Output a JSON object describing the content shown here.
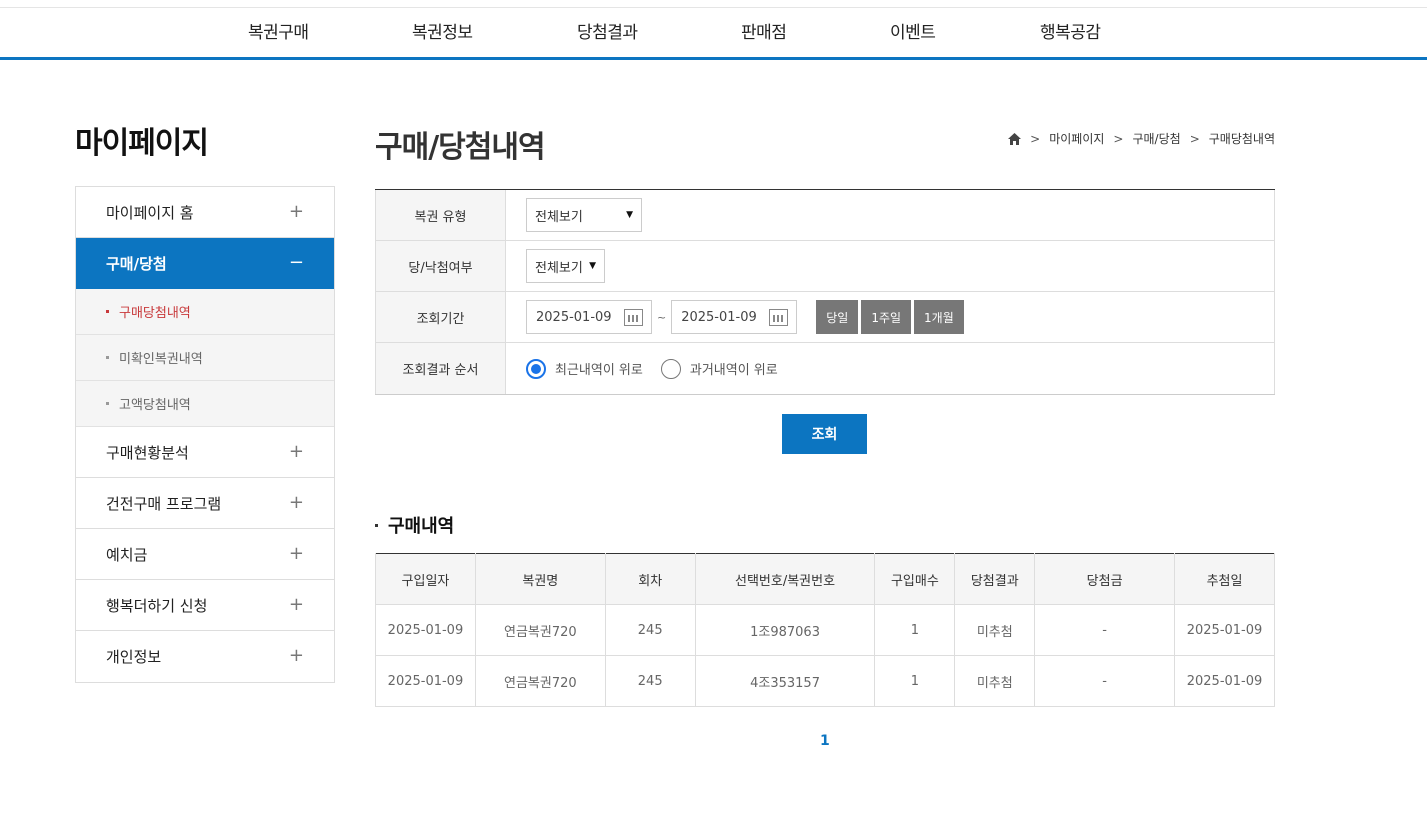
{
  "gnb": [
    "복권구매",
    "복권정보",
    "당첨결과",
    "판매점",
    "이벤트",
    "행복공감"
  ],
  "lnb": {
    "title": "마이페이지",
    "items": [
      {
        "label": "마이페이지 홈",
        "toggle": "+"
      },
      {
        "label": "구매/당첨",
        "toggle": "−"
      },
      {
        "label": "구매현황분석",
        "toggle": "+"
      },
      {
        "label": "건전구매 프로그램",
        "toggle": "+"
      },
      {
        "label": "예치금",
        "toggle": "+"
      },
      {
        "label": "행복더하기 신청",
        "toggle": "+"
      },
      {
        "label": "개인정보",
        "toggle": "+"
      }
    ],
    "sub": [
      "구매당첨내역",
      "미확인복권내역",
      "고액당첨내역"
    ]
  },
  "page": {
    "title": "구매/당첨내역",
    "breadcrumb": [
      "마이페이지",
      "구매/당첨",
      "구매당첨내역"
    ]
  },
  "search": {
    "type_label": "복권 유형",
    "type_value": "전체보기",
    "win_label": "당/낙첨여부",
    "win_value": "전체보기",
    "period_label": "조회기간",
    "date_from": "2025-01-09",
    "tilde": "~",
    "date_to": "2025-01-09",
    "period_buttons": [
      "당일",
      "1주일",
      "1개월"
    ],
    "order_label": "조회결과 순서",
    "order_options": [
      "최근내역이 위로",
      "과거내역이 위로"
    ],
    "submit": "조회"
  },
  "results": {
    "title": "구매내역",
    "headers": [
      "구입일자",
      "복권명",
      "회차",
      "선택번호/복권번호",
      "구입매수",
      "당첨결과",
      "당첨금",
      "추첨일"
    ],
    "rows": [
      [
        "2025-01-09",
        "연금복권720",
        "245",
        "1조987063",
        "1",
        "미추첨",
        "-",
        "2025-01-09"
      ],
      [
        "2025-01-09",
        "연금복권720",
        "245",
        "4조353157",
        "1",
        "미추첨",
        "-",
        "2025-01-09"
      ]
    ],
    "page": "1"
  },
  "colors": {
    "accent": "#0c75c1",
    "active_sub": "#c8393b",
    "period_btn": "#777777"
  }
}
